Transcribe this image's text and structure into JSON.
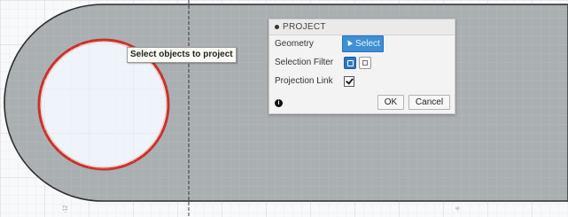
{
  "canvas": {
    "tooltip_text": "Select objects to project",
    "ruler_label_left": "-12",
    "ruler_label_right": "-6"
  },
  "dialog": {
    "title": "PROJECT",
    "rows": {
      "geometry_label": "Geometry",
      "select_button_label": "Select",
      "selection_filter_label": "Selection Filter",
      "projection_link_label": "Projection Link"
    },
    "projection_link_checked": true,
    "info_icon": "info-icon",
    "ok_label": "OK",
    "cancel_label": "Cancel"
  },
  "colors": {
    "sketch_face": "#aaafb2",
    "profile_outline": "#2b2b2b",
    "selected_circle": "#c8322a",
    "select_button": "#3d8fd6"
  }
}
